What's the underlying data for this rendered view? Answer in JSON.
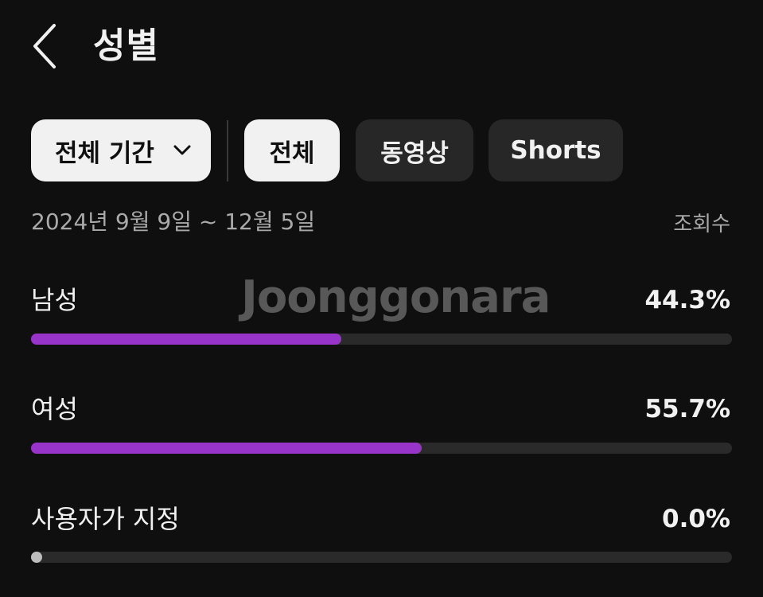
{
  "header": {
    "title": "성별"
  },
  "filters": {
    "period_label": "전체 기간",
    "chips": [
      {
        "label": "전체",
        "selected": true
      },
      {
        "label": "동영상",
        "selected": false
      },
      {
        "label": "Shorts",
        "selected": false
      }
    ]
  },
  "summary": {
    "date_range": "2024년 9월 9일 ~ 12월 5일",
    "metric": "조회수"
  },
  "watermark": "Joonggonara",
  "rows": [
    {
      "label": "남성",
      "value": "44.3%",
      "fraction": 0.443
    },
    {
      "label": "여성",
      "value": "55.7%",
      "fraction": 0.557
    },
    {
      "label": "사용자가 지정",
      "value": "0.0%",
      "fraction": 0.0
    }
  ],
  "colors": {
    "background": "#0f0f0f",
    "bar_fill": "#9834c9",
    "bar_track": "#2a2a2a",
    "chip_selected": "#f1f1f1",
    "chip_unselected": "#272727"
  },
  "icons": {
    "back": "chevron-left-icon",
    "period_dropdown": "chevron-down-icon"
  }
}
